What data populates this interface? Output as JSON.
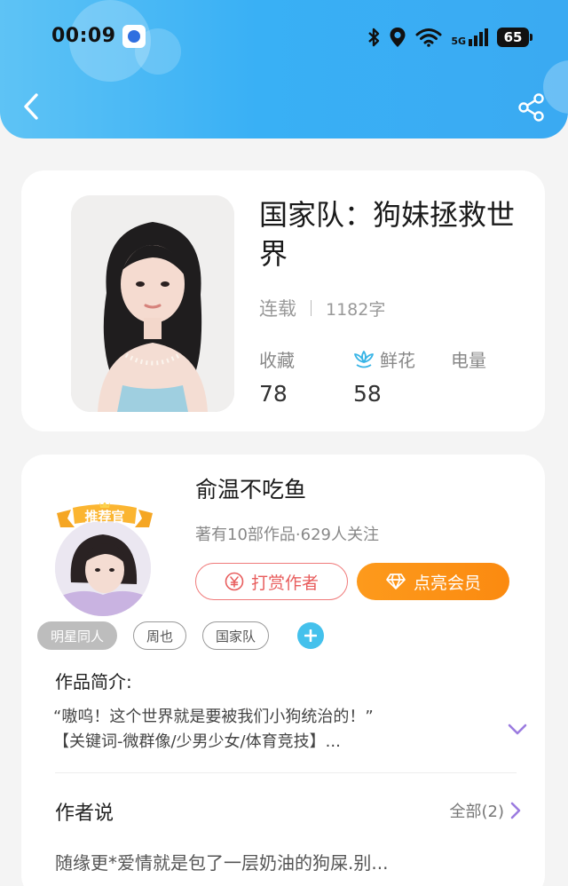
{
  "status_bar": {
    "time": "00:09",
    "network": "5G",
    "battery": "65"
  },
  "book": {
    "title": "国家队：狗妹拯救世界",
    "status": "连载",
    "word_count": "1182字",
    "stats": [
      {
        "label": "收藏",
        "value": "78"
      },
      {
        "label": "鲜花",
        "value": "58"
      },
      {
        "label": "电量",
        "value": ""
      }
    ]
  },
  "author": {
    "badge": "推荐官",
    "name": "俞温不吃鱼",
    "meta": "著有10部作品·629人关注",
    "tip_label": "打赏作者",
    "vip_label": "点亮会员"
  },
  "tags": [
    "明星同人",
    "周也",
    "国家队"
  ],
  "intro": {
    "label": "作品简介:",
    "line1": "“嗷呜！这个世界就是要被我们小狗统治的！”",
    "line2": "【关键词-微群像/少男少女/体育竞技】..."
  },
  "author_says": {
    "label": "作者说",
    "all_label": "全部(2)",
    "text": "随缘更*爱情就是包了一层奶油的狗屎.别..."
  },
  "colors": {
    "header": "#3aaaf2",
    "tip": "#e85d5d",
    "vip": "#fb8a10",
    "tag_add": "#44c1ec",
    "expand": "#9b7be0"
  },
  "icons": [
    "back-arrow-icon",
    "share-icon",
    "flower-icon",
    "yen-icon",
    "diamond-icon",
    "plus-icon",
    "chevron-down-icon",
    "chevron-right-icon"
  ]
}
